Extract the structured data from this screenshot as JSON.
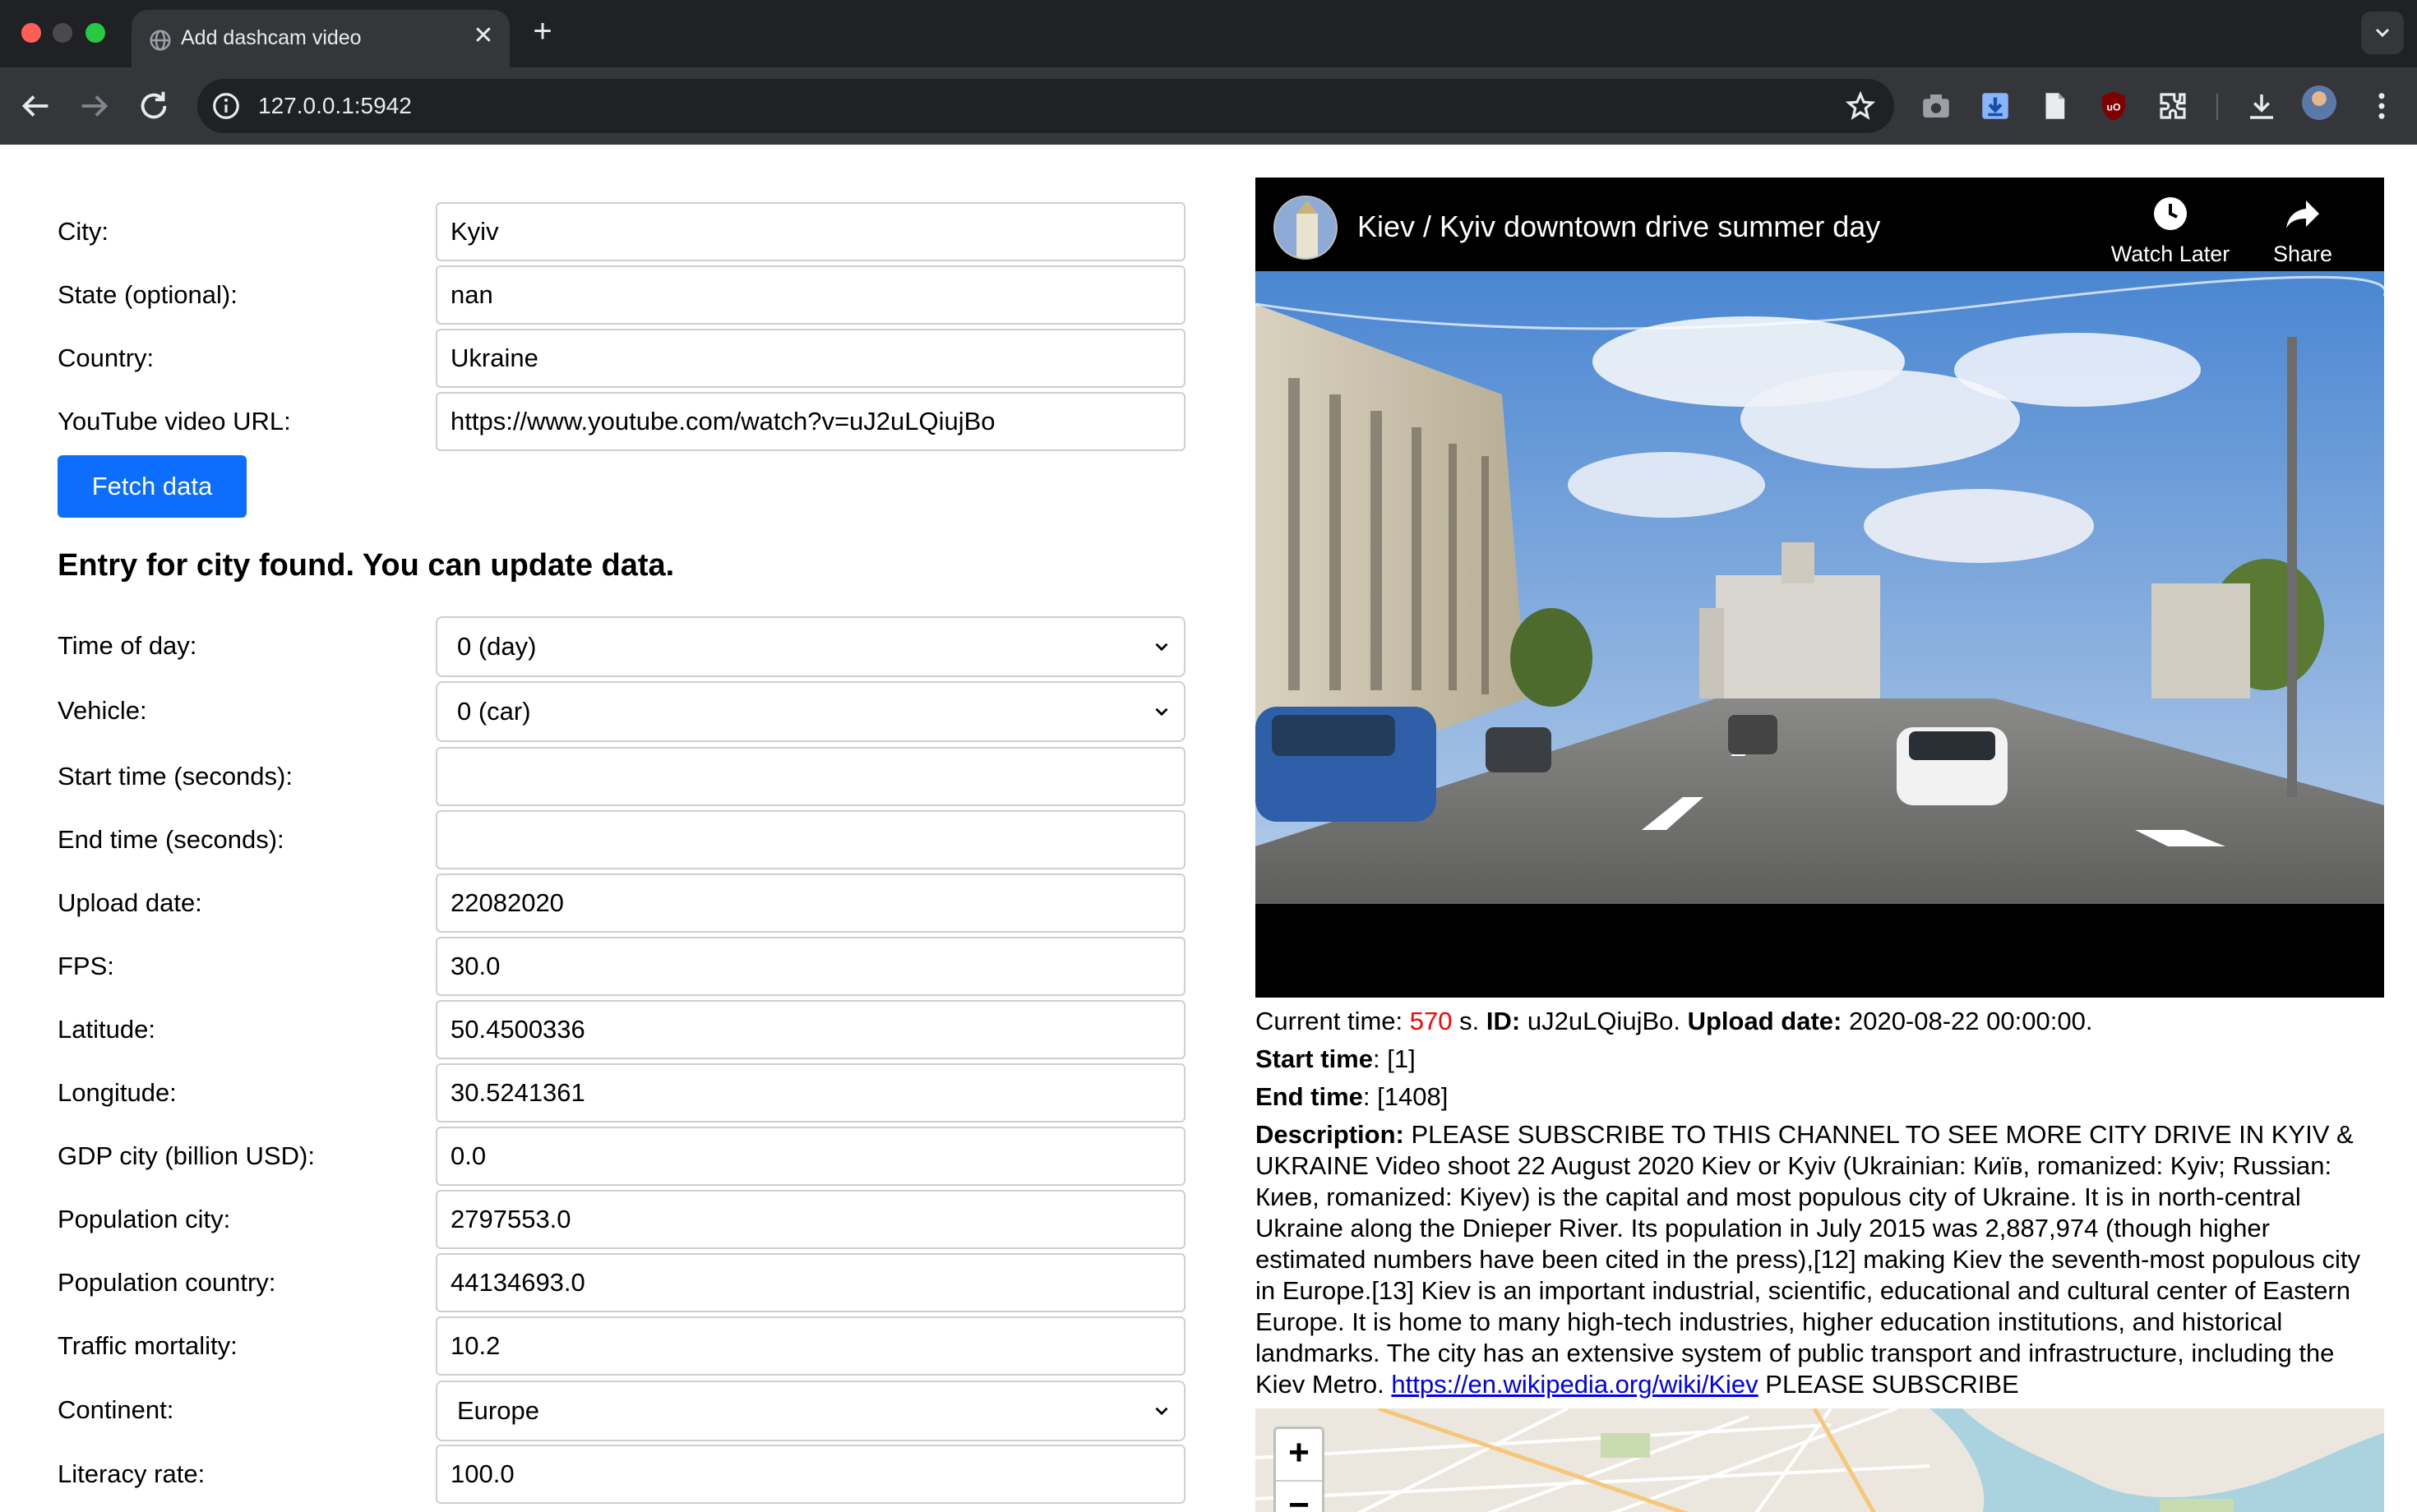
{
  "browser": {
    "tab_title": "Add dashcam video",
    "url": "127.0.0.1:5942"
  },
  "form": {
    "city": {
      "label": "City:",
      "value": "Kyiv"
    },
    "state": {
      "label": "State (optional):",
      "value": "nan"
    },
    "country": {
      "label": "Country:",
      "value": "Ukraine"
    },
    "youtube_url": {
      "label": "YouTube video URL:",
      "value": "https://www.youtube.com/watch?v=uJ2uLQiujBo"
    },
    "fetch_button": "Fetch data",
    "status_message": "Entry for city found. You can update data.",
    "time_of_day": {
      "label": "Time of day:",
      "value": "0 (day)"
    },
    "vehicle": {
      "label": "Vehicle:",
      "value": "0 (car)"
    },
    "start_time": {
      "label": "Start time (seconds):",
      "value": ""
    },
    "end_time": {
      "label": "End time (seconds):",
      "value": ""
    },
    "upload_date": {
      "label": "Upload date:",
      "value": "22082020"
    },
    "fps": {
      "label": "FPS:",
      "value": "30.0"
    },
    "latitude": {
      "label": "Latitude:",
      "value": "50.4500336"
    },
    "longitude": {
      "label": "Longitude:",
      "value": "30.5241361"
    },
    "gdp_city": {
      "label": "GDP city (billion USD):",
      "value": "0.0"
    },
    "population_city": {
      "label": "Population city:",
      "value": "2797553.0"
    },
    "population_country": {
      "label": "Population country:",
      "value": "44134693.0"
    },
    "traffic_mortality": {
      "label": "Traffic mortality:",
      "value": "10.2"
    },
    "continent": {
      "label": "Continent:",
      "value": "Europe"
    },
    "literacy_rate": {
      "label": "Literacy rate:",
      "value": "100.0"
    }
  },
  "player": {
    "video_title": "Kiev / Kyiv downtown drive summer day",
    "watch_later": "Watch Later",
    "share": "Share"
  },
  "info": {
    "current_time_label": "Current time:",
    "current_time_value": "570",
    "seconds_suffix": "s.",
    "id_label": "ID:",
    "id_value": "uJ2uLQiujBo.",
    "upload_date_label": "Upload date:",
    "upload_date_value": "2020-08-22 00:00:00.",
    "start_time_label": "Start time",
    "start_time_value": ": [1]",
    "end_time_label": "End time",
    "end_time_value": ": [1408]",
    "description_label": "Description:",
    "description_text": "PLEASE SUBSCRIBE TO THIS CHANNEL TO SEE MORE CITY DRIVE IN KYIV & UKRAINE Video shoot 22 August 2020 Kiev or Kyiv (Ukrainian: Київ, romanized: Kyiv; Russian: Киев, romanized: Kiyev) is the capital and most populous city of Ukraine. It is in north-central Ukraine along the Dnieper River. Its population in July 2015 was 2,887,974 (though higher estimated numbers have been cited in the press),[12] making Kiev the seventh-most populous city in Europe.[13] Kiev is an important industrial, scientific, educational and cultural center of Eastern Europe. It is home to many high-tech industries, higher education institutions, and historical landmarks. The city has an extensive system of public transport and infrastructure, including the Kiev Metro.",
    "description_link": "https://en.wikipedia.org/wiki/Kiev",
    "description_tail": "PLEASE SUBSCRIBE"
  },
  "map": {
    "zoom_in": "+",
    "zoom_out": "−"
  }
}
